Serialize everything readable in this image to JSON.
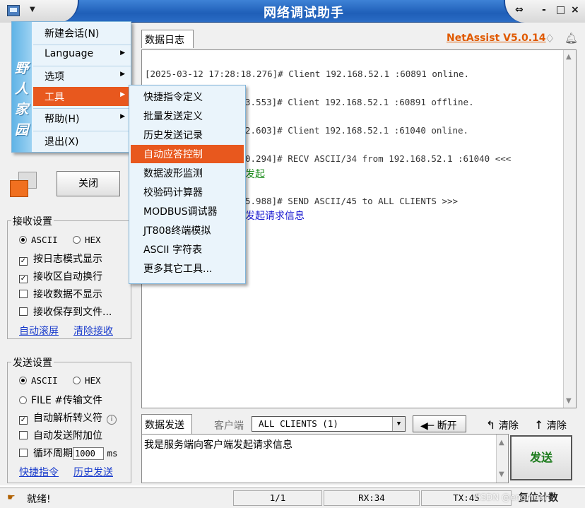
{
  "window": {
    "title": "网络调试助手",
    "version": "NetAssist V5.0.14",
    "controls": [
      "⇔",
      "-",
      "□",
      "×"
    ]
  },
  "log": {
    "tab_label": "数据日志",
    "lines": [
      "[2025-03-12 17:28:18.276]# Client 192.168.52.1 :60891 online.",
      "[2025-03-12 17:28:18.553]# Client 192.168.52.1 :60891 offline.",
      "[2025-03-12 17:28:22.603]# Client 192.168.52.1 :61040 online.",
      "[2025-03-12 17:28:30.294]# RECV ASCII/34 from 192.168.52.1 :61040 <<<",
      "[2025-03-12 17:28:35.988]# SEND ASCII/45 to ALL CLIENTS >>>"
    ],
    "visible_lines": [
      "[2025-03-12 17:28:18.276]# Client 192.168.52.1 :60891 online.",
      "3.553]# Client 192.168.52.1 :60891 offline.",
      "2.603]# Client 192.168.52.1 :61040 online.",
      "0.294]# RECV ASCII/34 from 192.168.52.1 :61040 <<<",
      "5.988]# SEND ASCII/45 to ALL CLIENTS >>>"
    ],
    "recv_fragment": "发起",
    "send_fragment": "发起请求信息"
  },
  "send": {
    "tab_label": "数据发送",
    "client_label": "客户端",
    "client_value": "ALL CLIENTS (1)",
    "disconnect_label": "断开",
    "clear_label_1": "清除",
    "clear_label_2": "清除",
    "text": "我是服务端向客户端发起请求信息",
    "send_button": "发送"
  },
  "left": {
    "close_button": "关闭",
    "recv_settings": {
      "title": "接收设置",
      "ascii": "ASCII",
      "hex": "HEX",
      "options": [
        "按日志模式显示",
        "接收区自动换行",
        "接收数据不显示",
        "接收保存到文件..."
      ],
      "checked": [
        true,
        true,
        false,
        false
      ],
      "link_autoscroll": "自动滚屏",
      "link_clear": "清除接收"
    },
    "send_settings": {
      "title": "发送设置",
      "ascii": "ASCII",
      "hex": "HEX",
      "file": "FILE #传输文件",
      "auto_parse": "自动解析转义符",
      "auto_append": "自动发送附加位",
      "cycle": "循环周期",
      "cycle_value": "1000",
      "cycle_unit": "ms",
      "link_shortcut": "快捷指令",
      "link_history": "历史发送"
    }
  },
  "main_menu": {
    "stripe_text": "野人家园",
    "items": [
      {
        "label": "新建会话(N)",
        "arrow": false
      },
      {
        "label": "Language",
        "arrow": true
      },
      {
        "label": "选项",
        "arrow": true
      },
      {
        "label": "工具",
        "arrow": true,
        "active": true
      },
      {
        "label": "帮助(H)",
        "arrow": true
      },
      {
        "label": "退出(X)",
        "arrow": false
      }
    ]
  },
  "tools_menu": {
    "items": [
      "快捷指令定义",
      "批量发送定义",
      "历史发送记录",
      "自动应答控制",
      "数据波形监测",
      "校验码计算器",
      "MODBUS调试器",
      "JT808终端模拟",
      "ASCII 字符表",
      "更多其它工具..."
    ],
    "active_index": 3
  },
  "status": {
    "text": "就绪!",
    "page": "1/1",
    "rx": "RX:34",
    "tx": "TX:45",
    "reset": "复位计数",
    "watermark": "CSDN @engineer"
  }
}
